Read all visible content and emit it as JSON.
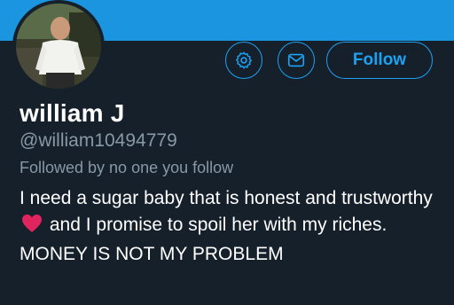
{
  "profile": {
    "name": "william J",
    "handle": "@william10494779",
    "followed_by": "Followed by no one you follow",
    "bio": {
      "part1": "I need a sugar baby that is honest and trustworthy",
      "emoji": "red-heart",
      "part2": "and I promise to spoil her with my riches. MONEY IS NOT MY PROBLEM"
    }
  },
  "actions": {
    "follow_label": "Follow",
    "settings_icon": "gear-icon",
    "message_icon": "envelope-icon"
  },
  "colors": {
    "background": "#15202b",
    "accent": "#1da1f2",
    "banner": "#1b95e0",
    "secondary_text": "#8899a6",
    "heart": "#e0245e"
  }
}
